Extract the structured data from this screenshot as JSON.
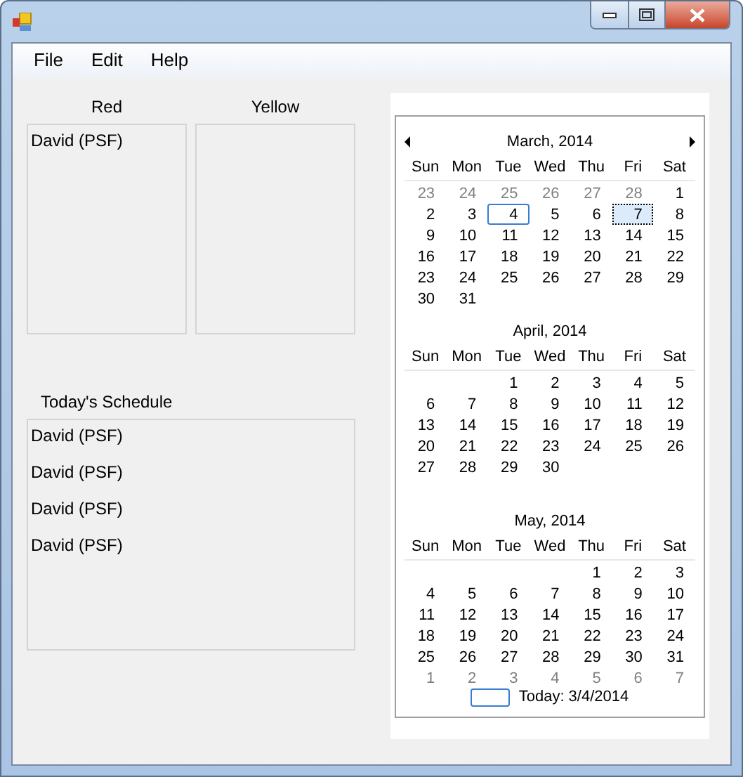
{
  "menu": [
    {
      "label": "File"
    },
    {
      "label": "Edit"
    },
    {
      "label": "Help"
    }
  ],
  "lists": [
    {
      "label": "Red",
      "items": [
        "David (PSF)"
      ]
    },
    {
      "label": "Yellow"
    }
  ],
  "schedule": {
    "label": "Today's Schedule",
    "items": [
      "David (PSF)",
      "David (PSF)",
      "David (PSF)",
      "David (PSF)"
    ]
  },
  "calendar": {
    "months": [
      {
        "title": "March, 2014",
        "nav": true,
        "weekdays": [
          "Sun",
          "Mon",
          "Tue",
          "Wed",
          "Thu",
          "Fri",
          "Sat"
        ],
        "weeks": [
          [
            {
              "d": "23",
              "kind": "other",
              "today": false,
              "selected": false
            },
            {
              "d": "24",
              "kind": "other",
              "today": false,
              "selected": false
            },
            {
              "d": "25",
              "kind": "other",
              "today": false,
              "selected": false
            },
            {
              "d": "26",
              "kind": "other",
              "today": false,
              "selected": false
            },
            {
              "d": "27",
              "kind": "other",
              "today": false,
              "selected": false
            },
            {
              "d": "28",
              "kind": "other",
              "today": false,
              "selected": false
            },
            {
              "d": "1",
              "kind": "day",
              "today": false,
              "selected": false
            }
          ],
          [
            {
              "d": "2",
              "kind": "day",
              "today": false,
              "selected": false
            },
            {
              "d": "3",
              "kind": "day",
              "today": false,
              "selected": false
            },
            {
              "d": "4",
              "kind": "day",
              "today": true,
              "selected": false
            },
            {
              "d": "5",
              "kind": "day",
              "today": false,
              "selected": false
            },
            {
              "d": "6",
              "kind": "day",
              "today": false,
              "selected": false
            },
            {
              "d": "7",
              "kind": "day",
              "today": false,
              "selected": true
            },
            {
              "d": "8",
              "kind": "day",
              "today": false,
              "selected": false
            }
          ],
          [
            {
              "d": "9",
              "kind": "day",
              "today": false,
              "selected": false
            },
            {
              "d": "10",
              "kind": "day",
              "today": false,
              "selected": false
            },
            {
              "d": "11",
              "kind": "day",
              "today": false,
              "selected": false
            },
            {
              "d": "12",
              "kind": "day",
              "today": false,
              "selected": false
            },
            {
              "d": "13",
              "kind": "day",
              "today": false,
              "selected": false
            },
            {
              "d": "14",
              "kind": "day",
              "today": false,
              "selected": false
            },
            {
              "d": "15",
              "kind": "day",
              "today": false,
              "selected": false
            }
          ],
          [
            {
              "d": "16",
              "kind": "day",
              "today": false,
              "selected": false
            },
            {
              "d": "17",
              "kind": "day",
              "today": false,
              "selected": false
            },
            {
              "d": "18",
              "kind": "day",
              "today": false,
              "selected": false
            },
            {
              "d": "19",
              "kind": "day",
              "today": false,
              "selected": false
            },
            {
              "d": "20",
              "kind": "day",
              "today": false,
              "selected": false
            },
            {
              "d": "21",
              "kind": "day",
              "today": false,
              "selected": false
            },
            {
              "d": "22",
              "kind": "day",
              "today": false,
              "selected": false
            }
          ],
          [
            {
              "d": "23",
              "kind": "day",
              "today": false,
              "selected": false
            },
            {
              "d": "24",
              "kind": "day",
              "today": false,
              "selected": false
            },
            {
              "d": "25",
              "kind": "day",
              "today": false,
              "selected": false
            },
            {
              "d": "26",
              "kind": "day",
              "today": false,
              "selected": false
            },
            {
              "d": "27",
              "kind": "day",
              "today": false,
              "selected": false
            },
            {
              "d": "28",
              "kind": "day",
              "today": false,
              "selected": false
            },
            {
              "d": "29",
              "kind": "day",
              "today": false,
              "selected": false
            }
          ],
          [
            {
              "d": "30",
              "kind": "day",
              "today": false,
              "selected": false
            },
            {
              "d": "31",
              "kind": "day",
              "today": false,
              "selected": false
            }
          ]
        ]
      },
      {
        "title": "April, 2014",
        "nav": false,
        "weekdays": [
          "Sun",
          "Mon",
          "Tue",
          "Wed",
          "Thu",
          "Fri",
          "Sat"
        ],
        "weeks": [
          [
            {
              "kind": "blank"
            },
            {
              "kind": "blank"
            },
            {
              "d": "1",
              "kind": "day",
              "today": false,
              "selected": false
            },
            {
              "d": "2",
              "kind": "day",
              "today": false,
              "selected": false
            },
            {
              "d": "3",
              "kind": "day",
              "today": false,
              "selected": false
            },
            {
              "d": "4",
              "kind": "day",
              "today": false,
              "selected": false
            },
            {
              "d": "5",
              "kind": "day",
              "today": false,
              "selected": false
            }
          ],
          [
            {
              "d": "6",
              "kind": "day",
              "today": false,
              "selected": false
            },
            {
              "d": "7",
              "kind": "day",
              "today": false,
              "selected": false
            },
            {
              "d": "8",
              "kind": "day",
              "today": false,
              "selected": false
            },
            {
              "d": "9",
              "kind": "day",
              "today": false,
              "selected": false
            },
            {
              "d": "10",
              "kind": "day",
              "today": false,
              "selected": false
            },
            {
              "d": "11",
              "kind": "day",
              "today": false,
              "selected": false
            },
            {
              "d": "12",
              "kind": "day",
              "today": false,
              "selected": false
            }
          ],
          [
            {
              "d": "13",
              "kind": "day",
              "today": false,
              "selected": false
            },
            {
              "d": "14",
              "kind": "day",
              "today": false,
              "selected": false
            },
            {
              "d": "15",
              "kind": "day",
              "today": false,
              "selected": false
            },
            {
              "d": "16",
              "kind": "day",
              "today": false,
              "selected": false
            },
            {
              "d": "17",
              "kind": "day",
              "today": false,
              "selected": false
            },
            {
              "d": "18",
              "kind": "day",
              "today": false,
              "selected": false
            },
            {
              "d": "19",
              "kind": "day",
              "today": false,
              "selected": false
            }
          ],
          [
            {
              "d": "20",
              "kind": "day",
              "today": false,
              "selected": false
            },
            {
              "d": "21",
              "kind": "day",
              "today": false,
              "selected": false
            },
            {
              "d": "22",
              "kind": "day",
              "today": false,
              "selected": false
            },
            {
              "d": "23",
              "kind": "day",
              "today": false,
              "selected": false
            },
            {
              "d": "24",
              "kind": "day",
              "today": false,
              "selected": false
            },
            {
              "d": "25",
              "kind": "day",
              "today": false,
              "selected": false
            },
            {
              "d": "26",
              "kind": "day",
              "today": false,
              "selected": false
            }
          ],
          [
            {
              "d": "27",
              "kind": "day",
              "today": false,
              "selected": false
            },
            {
              "d": "28",
              "kind": "day",
              "today": false,
              "selected": false
            },
            {
              "d": "29",
              "kind": "day",
              "today": false,
              "selected": false
            },
            {
              "d": "30",
              "kind": "day",
              "today": false,
              "selected": false
            }
          ]
        ]
      },
      {
        "title": "May, 2014",
        "nav": false,
        "weekdays": [
          "Sun",
          "Mon",
          "Tue",
          "Wed",
          "Thu",
          "Fri",
          "Sat"
        ],
        "weeks": [
          [
            {
              "kind": "blank"
            },
            {
              "kind": "blank"
            },
            {
              "kind": "blank"
            },
            {
              "kind": "blank"
            },
            {
              "d": "1",
              "kind": "day",
              "today": false,
              "selected": false
            },
            {
              "d": "2",
              "kind": "day",
              "today": false,
              "selected": false
            },
            {
              "d": "3",
              "kind": "day",
              "today": false,
              "selected": false
            }
          ],
          [
            {
              "d": "4",
              "kind": "day",
              "today": false,
              "selected": false
            },
            {
              "d": "5",
              "kind": "day",
              "today": false,
              "selected": false
            },
            {
              "d": "6",
              "kind": "day",
              "today": false,
              "selected": false
            },
            {
              "d": "7",
              "kind": "day",
              "today": false,
              "selected": false
            },
            {
              "d": "8",
              "kind": "day",
              "today": false,
              "selected": false
            },
            {
              "d": "9",
              "kind": "day",
              "today": false,
              "selected": false
            },
            {
              "d": "10",
              "kind": "day",
              "today": false,
              "selected": false
            }
          ],
          [
            {
              "d": "11",
              "kind": "day",
              "today": false,
              "selected": false
            },
            {
              "d": "12",
              "kind": "day",
              "today": false,
              "selected": false
            },
            {
              "d": "13",
              "kind": "day",
              "today": false,
              "selected": false
            },
            {
              "d": "14",
              "kind": "day",
              "today": false,
              "selected": false
            },
            {
              "d": "15",
              "kind": "day",
              "today": false,
              "selected": false
            },
            {
              "d": "16",
              "kind": "day",
              "today": false,
              "selected": false
            },
            {
              "d": "17",
              "kind": "day",
              "today": false,
              "selected": false
            }
          ],
          [
            {
              "d": "18",
              "kind": "day",
              "today": false,
              "selected": false
            },
            {
              "d": "19",
              "kind": "day",
              "today": false,
              "selected": false
            },
            {
              "d": "20",
              "kind": "day",
              "today": false,
              "selected": false
            },
            {
              "d": "21",
              "kind": "day",
              "today": false,
              "selected": false
            },
            {
              "d": "22",
              "kind": "day",
              "today": false,
              "selected": false
            },
            {
              "d": "23",
              "kind": "day",
              "today": false,
              "selected": false
            },
            {
              "d": "24",
              "kind": "day",
              "today": false,
              "selected": false
            }
          ],
          [
            {
              "d": "25",
              "kind": "day",
              "today": false,
              "selected": false
            },
            {
              "d": "26",
              "kind": "day",
              "today": false,
              "selected": false
            },
            {
              "d": "27",
              "kind": "day",
              "today": false,
              "selected": false
            },
            {
              "d": "28",
              "kind": "day",
              "today": false,
              "selected": false
            },
            {
              "d": "29",
              "kind": "day",
              "today": false,
              "selected": false
            },
            {
              "d": "30",
              "kind": "day",
              "today": false,
              "selected": false
            },
            {
              "d": "31",
              "kind": "day",
              "today": false,
              "selected": false
            }
          ],
          [
            {
              "d": "1",
              "kind": "other",
              "today": false,
              "selected": false
            },
            {
              "d": "2",
              "kind": "other",
              "today": false,
              "selected": false
            },
            {
              "d": "3",
              "kind": "other",
              "today": false,
              "selected": false
            },
            {
              "d": "4",
              "kind": "other",
              "today": false,
              "selected": false
            },
            {
              "d": "5",
              "kind": "other",
              "today": false,
              "selected": false
            },
            {
              "d": "6",
              "kind": "other",
              "today": false,
              "selected": false
            },
            {
              "d": "7",
              "kind": "other",
              "today": false,
              "selected": false
            }
          ]
        ]
      }
    ],
    "today_label": "Today: 3/4/2014"
  }
}
